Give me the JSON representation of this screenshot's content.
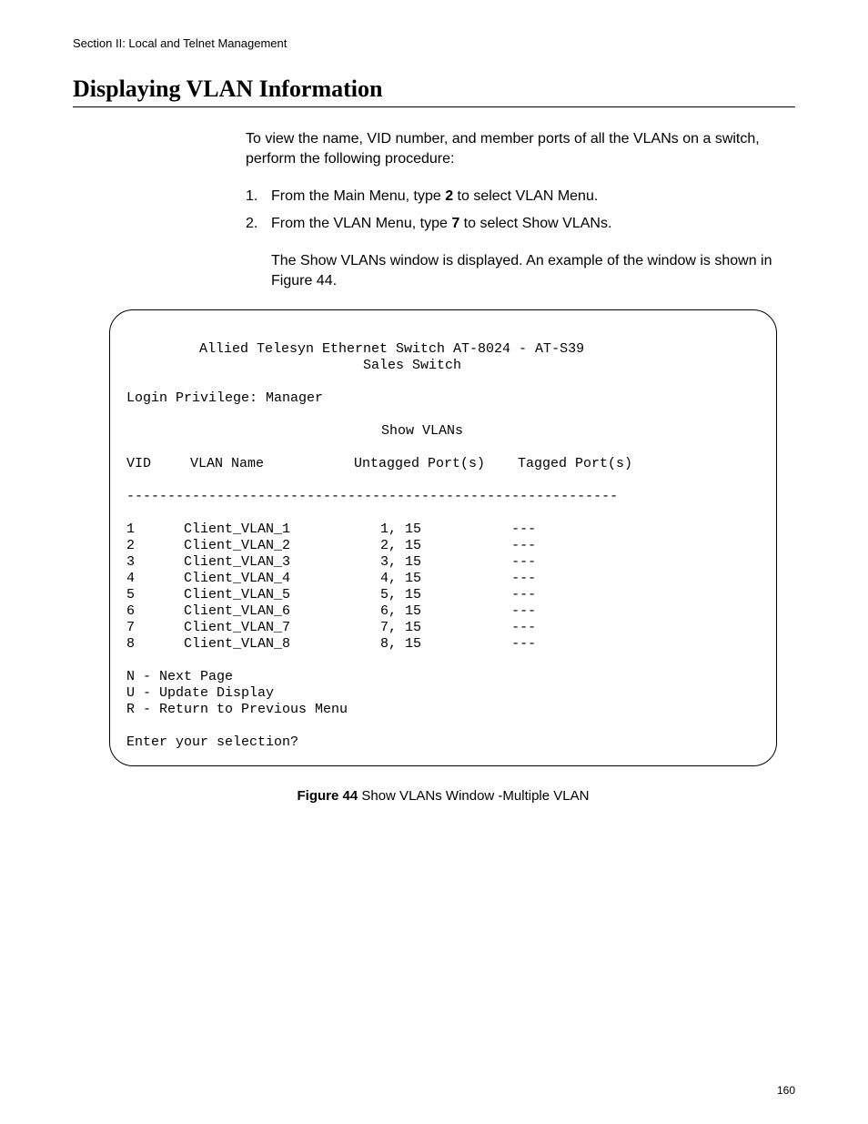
{
  "header": {
    "section": "Section II: Local and Telnet Management"
  },
  "title": "Displaying VLAN Information",
  "intro": "To view the name, VID number, and member ports of all the VLANs on a switch, perform the following procedure:",
  "steps": [
    {
      "num": "1.",
      "pre": "From the Main Menu, type ",
      "bold": "2",
      "post": " to select VLAN Menu."
    },
    {
      "num": "2.",
      "pre": "From the VLAN Menu, type ",
      "bold": "7",
      "post": " to select Show VLANs."
    }
  ],
  "result": "The Show VLANs window is displayed. An example of the window is shown in Figure 44.",
  "terminal": {
    "line1": "Allied Telesyn Ethernet Switch AT-8024 - AT-S39",
    "line2": "Sales Switch",
    "login": "Login Privilege: Manager",
    "screen_title": "Show VLANs",
    "cols": {
      "vid": "VID",
      "name": "VLAN Name",
      "untagged": "Untagged Port(s)",
      "tagged": "Tagged Port(s)"
    },
    "divider": "------------------------------------------------------------",
    "rows": [
      {
        "vid": "1",
        "name": "Client_VLAN_1",
        "untagged": "1, 15",
        "tagged": "---"
      },
      {
        "vid": "2",
        "name": "Client_VLAN_2",
        "untagged": "2, 15",
        "tagged": "---"
      },
      {
        "vid": "3",
        "name": "Client_VLAN_3",
        "untagged": "3, 15",
        "tagged": "---"
      },
      {
        "vid": "4",
        "name": "Client_VLAN_4",
        "untagged": "4, 15",
        "tagged": "---"
      },
      {
        "vid": "5",
        "name": "Client_VLAN_5",
        "untagged": "5, 15",
        "tagged": "---"
      },
      {
        "vid": "6",
        "name": "Client_VLAN_6",
        "untagged": "6, 15",
        "tagged": "---"
      },
      {
        "vid": "7",
        "name": "Client_VLAN_7",
        "untagged": "7, 15",
        "tagged": "---"
      },
      {
        "vid": "8",
        "name": "Client_VLAN_8",
        "untagged": "8, 15",
        "tagged": "---"
      }
    ],
    "menu": [
      "N - Next Page",
      "U - Update Display",
      "R - Return to Previous Menu"
    ],
    "prompt": "Enter your selection?"
  },
  "figure": {
    "label": "Figure 44",
    "caption": "  Show VLANs Window -Multiple VLAN"
  },
  "pagenum": "160"
}
